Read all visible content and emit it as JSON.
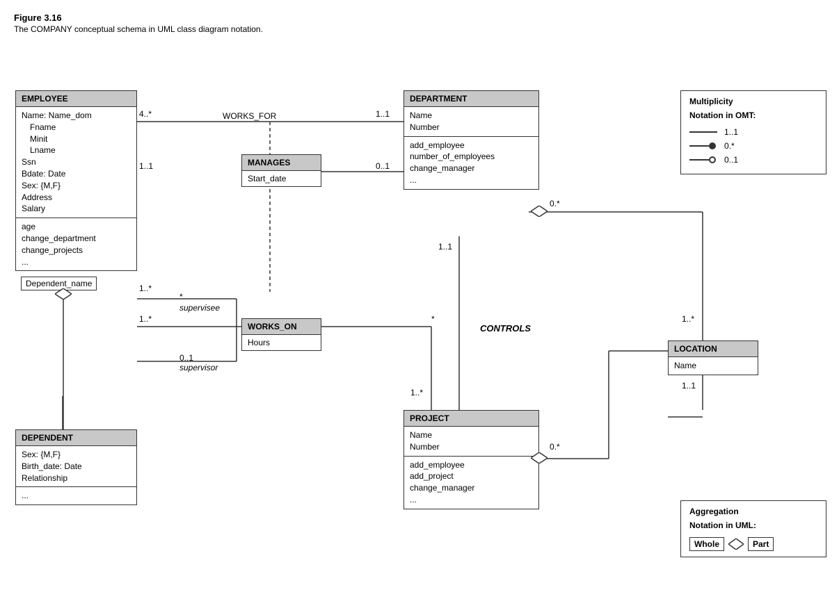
{
  "figure": {
    "title": "Figure 3.16",
    "caption": "The COMPANY conceptual schema in UML class diagram notation."
  },
  "classes": {
    "employee": {
      "name": "EMPLOYEE",
      "attributes": [
        "Name: Name_dom",
        "    Fname",
        "    Minit",
        "    Lname",
        "Ssn",
        "Bdate: Date",
        "Sex: {M,F}",
        "Address",
        "Salary"
      ],
      "methods": [
        "age",
        "change_department",
        "change_projects",
        "..."
      ]
    },
    "department": {
      "name": "DEPARTMENT",
      "attributes": [
        "Name",
        "Number"
      ],
      "methods": [
        "add_employee",
        "number_of_employees",
        "change_manager",
        "..."
      ]
    },
    "project": {
      "name": "PROJECT",
      "attributes": [
        "Name",
        "Number"
      ],
      "methods": [
        "add_employee",
        "add_project",
        "change_manager",
        "..."
      ]
    },
    "dependent": {
      "name": "DEPENDENT",
      "attributes": [
        "Sex: {M,F}",
        "Birth_date: Date",
        "Relationship"
      ],
      "methods": [
        "..."
      ]
    },
    "location": {
      "name": "LOCATION",
      "attributes": [
        "Name"
      ],
      "methods": []
    }
  },
  "associations": {
    "manages": {
      "name": "MANAGES",
      "attr": "Start_date"
    },
    "works_on": {
      "name": "WORKS_ON",
      "attr": "Hours"
    }
  },
  "labels": {
    "works_for": "WORKS_FOR",
    "controls": "CONTROLS",
    "supervisee": "supervisee",
    "supervisor": "supervisor",
    "dependent_name": "Dependent_name"
  },
  "multiplicities": {
    "works_for_left": "4..*",
    "works_for_right": "1..1",
    "manages_top_left": "1..1",
    "manages_top_right": "0..1",
    "manages_bottom_left": "1..*",
    "supervisee_mult": "*",
    "supervisor_mult": "0..1",
    "works_on_right": "*",
    "controls_top": "1..1",
    "controls_bottom": "1..*",
    "controls_right_star": "*",
    "dept_location_top": "0.*",
    "dept_location_bottom": "1..*",
    "location_bottom": "1..1",
    "project_location": "0.*"
  },
  "legend_multiplicity": {
    "title1": "Multiplicity",
    "title2": "Notation in OMT:",
    "row1": "1..1",
    "row2": "0.*",
    "row3": "0..1"
  },
  "legend_aggregation": {
    "title1": "Aggregation",
    "title2": "Notation in UML:",
    "whole_label": "Whole",
    "part_label": "Part"
  }
}
